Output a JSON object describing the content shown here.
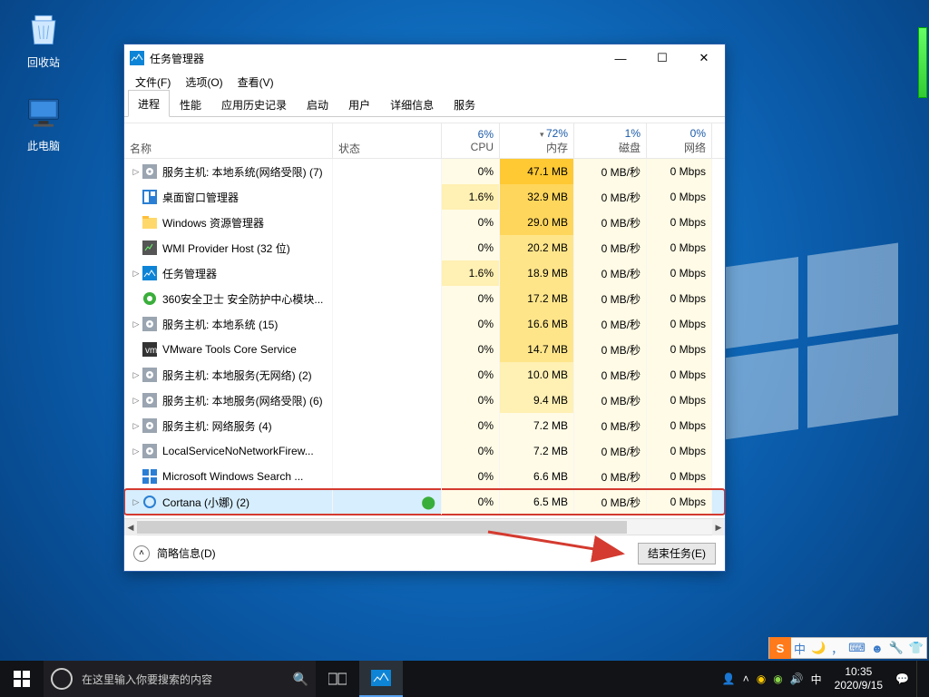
{
  "desktop": {
    "recycle_bin": "回收站",
    "this_pc": "此电脑"
  },
  "window": {
    "title": "任务管理器",
    "controls": {
      "min": "—",
      "max": "☐",
      "close": "✕"
    }
  },
  "menubar": {
    "file": "文件(F)",
    "options": "选项(O)",
    "view": "查看(V)"
  },
  "tabs": [
    "进程",
    "性能",
    "应用历史记录",
    "启动",
    "用户",
    "详细信息",
    "服务"
  ],
  "columns": {
    "name": "名称",
    "status": "状态",
    "cpu_pct": "6%",
    "cpu": "CPU",
    "mem_pct": "72%",
    "mem": "内存",
    "disk_pct": "1%",
    "disk": "磁盘",
    "net_pct": "0%",
    "net": "网络"
  },
  "processes": [
    {
      "exp": true,
      "icon": "svc",
      "name": "服务主机: 本地系统(网络受限) (7)",
      "cpu": "0%",
      "mem": "47.1 MB",
      "disk": "0 MB/秒",
      "net": "0 Mbps"
    },
    {
      "exp": false,
      "icon": "dwm",
      "name": "桌面窗口管理器",
      "cpu": "1.6%",
      "mem": "32.9 MB",
      "disk": "0 MB/秒",
      "net": "0 Mbps"
    },
    {
      "exp": false,
      "icon": "exp",
      "name": "Windows 资源管理器",
      "cpu": "0%",
      "mem": "29.0 MB",
      "disk": "0 MB/秒",
      "net": "0 Mbps"
    },
    {
      "exp": false,
      "icon": "wmi",
      "name": "WMI Provider Host (32 位)",
      "cpu": "0%",
      "mem": "20.2 MB",
      "disk": "0 MB/秒",
      "net": "0 Mbps"
    },
    {
      "exp": true,
      "icon": "tm",
      "name": "任务管理器",
      "cpu": "1.6%",
      "mem": "18.9 MB",
      "disk": "0 MB/秒",
      "net": "0 Mbps"
    },
    {
      "exp": false,
      "icon": "360",
      "name": "360安全卫士 安全防护中心模块...",
      "cpu": "0%",
      "mem": "17.2 MB",
      "disk": "0 MB/秒",
      "net": "0 Mbps"
    },
    {
      "exp": true,
      "icon": "svc",
      "name": "服务主机: 本地系统 (15)",
      "cpu": "0%",
      "mem": "16.6 MB",
      "disk": "0 MB/秒",
      "net": "0 Mbps"
    },
    {
      "exp": false,
      "icon": "vm",
      "name": "VMware Tools Core Service",
      "cpu": "0%",
      "mem": "14.7 MB",
      "disk": "0 MB/秒",
      "net": "0 Mbps"
    },
    {
      "exp": true,
      "icon": "svc",
      "name": "服务主机: 本地服务(无网络) (2)",
      "cpu": "0%",
      "mem": "10.0 MB",
      "disk": "0 MB/秒",
      "net": "0 Mbps"
    },
    {
      "exp": true,
      "icon": "svc",
      "name": "服务主机: 本地服务(网络受限) (6)",
      "cpu": "0%",
      "mem": "9.4 MB",
      "disk": "0 MB/秒",
      "net": "0 Mbps"
    },
    {
      "exp": true,
      "icon": "svc",
      "name": "服务主机: 网络服务 (4)",
      "cpu": "0%",
      "mem": "7.2 MB",
      "disk": "0 MB/秒",
      "net": "0 Mbps"
    },
    {
      "exp": true,
      "icon": "svc",
      "name": "LocalServiceNoNetworkFirew...",
      "cpu": "0%",
      "mem": "7.2 MB",
      "disk": "0 MB/秒",
      "net": "0 Mbps"
    },
    {
      "exp": false,
      "icon": "win",
      "name": "Microsoft Windows Search ...",
      "cpu": "0%",
      "mem": "6.6 MB",
      "disk": "0 MB/秒",
      "net": "0 Mbps"
    },
    {
      "exp": true,
      "icon": "cor",
      "name": "Cortana (小娜) (2)",
      "cpu": "0%",
      "mem": "6.5 MB",
      "disk": "0 MB/秒",
      "net": "0 Mbps",
      "selected": true,
      "leaf": true
    }
  ],
  "footer": {
    "fewer": "简略信息(D)",
    "end_task": "结束任务(E)"
  },
  "search": {
    "placeholder": "在这里输入你要搜索的内容"
  },
  "ime": {
    "lang": "中",
    "punct": "，",
    "keyboard": "⌨",
    "tool": "🔧",
    "shirt": "👕"
  },
  "tray": {
    "ime": "中",
    "time": "10:35",
    "date": "2020/9/15"
  }
}
